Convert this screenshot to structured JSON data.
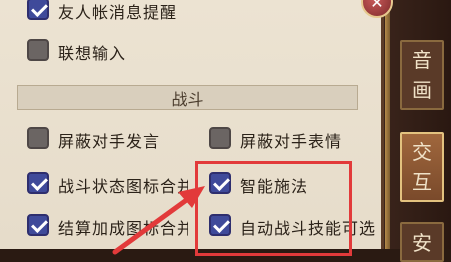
{
  "close_glyph": "✕",
  "options": {
    "friend_notify": "友人帐消息提醒",
    "assoc_input": "联想输入",
    "block_chat": "屏蔽对手发言",
    "block_emote": "屏蔽对手表情",
    "battle_icon_merge": "战斗状态图标合并",
    "smart_cast": "智能施法",
    "settle_icon_merge": "结算加成图标合并",
    "auto_skill": "自动战斗技能可选"
  },
  "section": {
    "battle": "战斗"
  },
  "tabs": {
    "sound_1": "音",
    "sound_2": "画",
    "interact_1": "交",
    "interact_2": "互",
    "safety_1": "安"
  },
  "colors": {
    "highlight": "#e23a3a",
    "check_on": "#3f4a9a"
  }
}
